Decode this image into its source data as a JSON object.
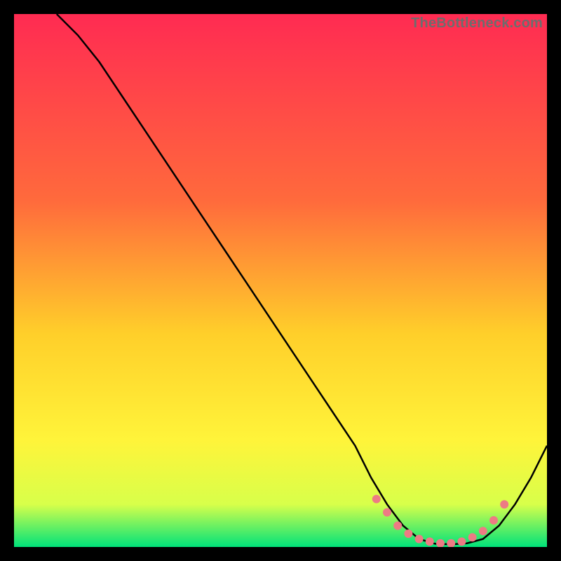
{
  "watermark": "TheBottleneck.com",
  "colors": {
    "gradient_top": "#ff2b52",
    "gradient_mid1": "#ff6a3c",
    "gradient_mid2": "#ffcf2a",
    "gradient_mid3": "#fff43a",
    "gradient_mid4": "#d8ff4a",
    "gradient_bottom": "#00e27a",
    "curve": "#000000",
    "marker": "#ed7b84",
    "frame": "#000000"
  },
  "chart_data": {
    "type": "line",
    "title": "",
    "xlabel": "",
    "ylabel": "",
    "xlim": [
      0,
      100
    ],
    "ylim": [
      0,
      100
    ],
    "grid": false,
    "series": [
      {
        "name": "bottleneck-curve",
        "x": [
          8,
          12,
          16,
          20,
          24,
          28,
          32,
          36,
          40,
          44,
          48,
          52,
          56,
          60,
          64,
          67,
          70,
          73,
          76,
          79,
          82,
          85,
          88,
          91,
          94,
          97,
          100
        ],
        "y": [
          100,
          96,
          91,
          85,
          79,
          73,
          67,
          61,
          55,
          49,
          43,
          37,
          31,
          25,
          19,
          13,
          8,
          4,
          1.5,
          0.6,
          0.5,
          0.7,
          1.5,
          4,
          8,
          13,
          19
        ]
      }
    ],
    "markers": {
      "name": "optimal-zone",
      "x": [
        68,
        70,
        72,
        74,
        76,
        78,
        80,
        82,
        84,
        86,
        88,
        90,
        92
      ],
      "y": [
        9,
        6.5,
        4,
        2.5,
        1.5,
        1,
        0.7,
        0.7,
        1,
        1.8,
        3,
        5,
        8
      ]
    }
  }
}
